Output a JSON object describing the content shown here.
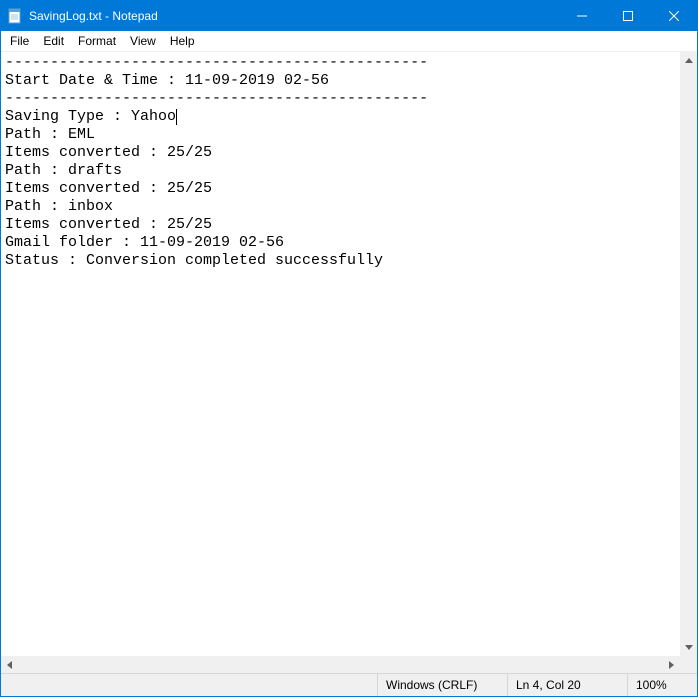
{
  "window": {
    "title": "SavingLog.txt - Notepad"
  },
  "menu": {
    "file": "File",
    "edit": "Edit",
    "format": "Format",
    "view": "View",
    "help": "Help"
  },
  "document": {
    "lines": [
      "-----------------------------------------------",
      "Start Date & Time : 11-09-2019 02-56",
      "-----------------------------------------------",
      "Saving Type : Yahoo",
      "Path : EML",
      "Items converted : 25/25",
      "Path : drafts",
      "Items converted : 25/25",
      "Path : inbox",
      "Items converted : 25/25",
      "Gmail folder : 11-09-2019 02-56",
      "Status : Conversion completed successfully"
    ]
  },
  "status": {
    "encoding": "Windows (CRLF)",
    "position": "Ln 4, Col 20",
    "zoom": "100%"
  }
}
